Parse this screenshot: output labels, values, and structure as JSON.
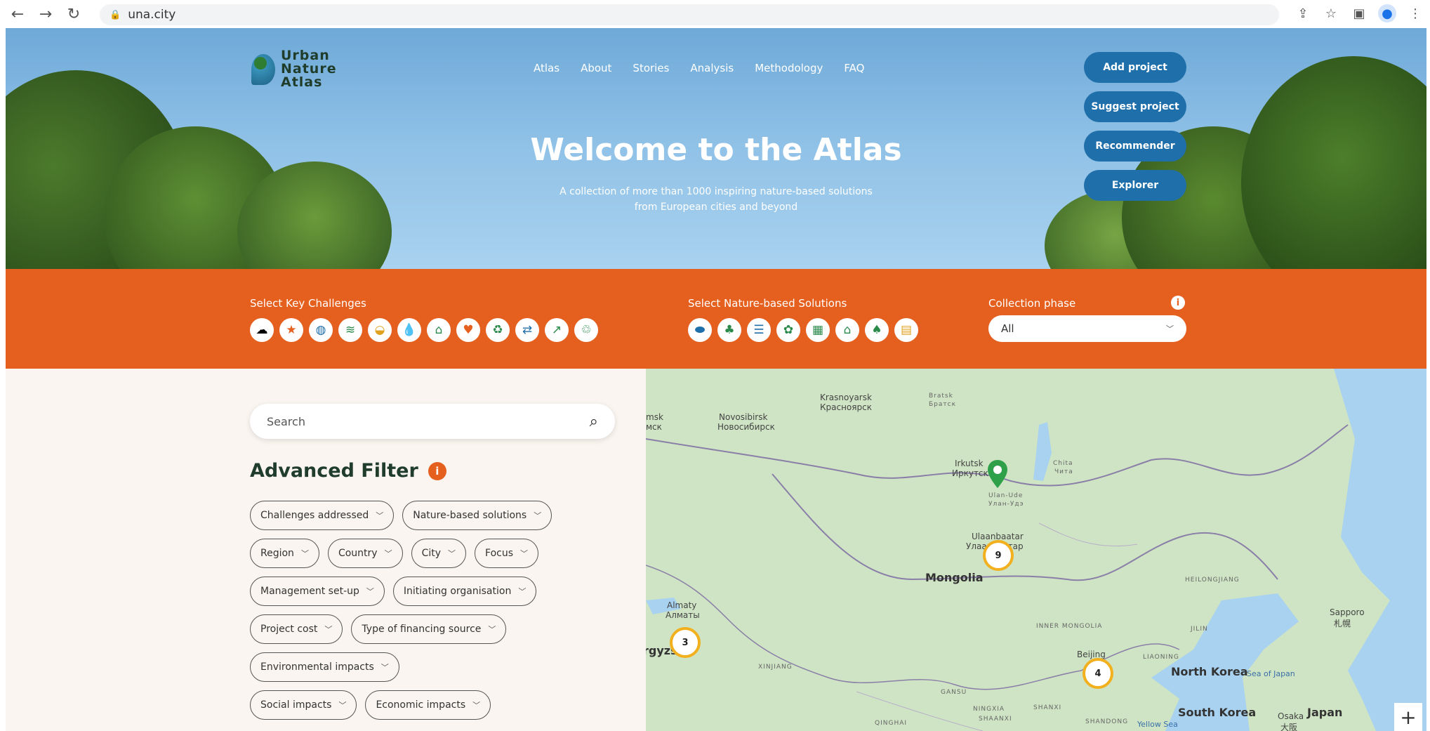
{
  "browser": {
    "url": "una.city"
  },
  "logo": {
    "line1": "Urban",
    "line2": "Nature",
    "line3": "Atlas"
  },
  "nav": [
    "Atlas",
    "About",
    "Stories",
    "Analysis",
    "Methodology",
    "FAQ"
  ],
  "hero": {
    "title": "Welcome to the Atlas",
    "subtitle_line1": "A collection of more than 1000 inspiring nature-based solutions",
    "subtitle_line2": "from European cities and beyond"
  },
  "hero_buttons": [
    "Add project",
    "Suggest project",
    "Recommender",
    "Explorer"
  ],
  "filters_band": {
    "challenges_label": "Select Key Challenges",
    "nbs_label": "Select Nature-based Solutions",
    "phase_label": "Collection phase",
    "phase_value": "All",
    "challenge_icons": [
      "cloud-icon",
      "star-icon",
      "globe-icon",
      "wetland-icon",
      "landscape-icon",
      "water-drop-icon",
      "building-icon",
      "heart-icon",
      "recycle-icon",
      "handshake-icon",
      "growth-chart-icon",
      "recycle-leaf-icon"
    ],
    "nbs_icons": [
      "blue-space-icon",
      "tree-icon",
      "water-infrastructure-icon",
      "plant-icon",
      "green-building-icon",
      "house-icon",
      "park-icon",
      "grid-icon"
    ]
  },
  "search": {
    "placeholder": "Search"
  },
  "advanced_filter": {
    "title": "Advanced Filter",
    "info": "i",
    "rows": [
      [
        "Challenges addressed",
        "Nature-based solutions"
      ],
      [
        "Region",
        "Country",
        "City",
        "Focus"
      ],
      [
        "Management set-up",
        "Initiating organisation"
      ],
      [
        "Project cost",
        "Type of financing source"
      ],
      [
        "Environmental impacts"
      ],
      [
        "Social impacts",
        "Economic impacts"
      ]
    ]
  },
  "map": {
    "labels": {
      "krasnoyarsk": "Krasnoyarsk",
      "krasnoyarsk_ru": "Красноярск",
      "bratsk": "Bratsk",
      "bratsk_ru": "Братск",
      "novosibirsk": "Novosibirsk",
      "novosibirsk_ru": "Новосибирск",
      "tomsk": "msk",
      "tomsk2": "мск",
      "irkutsk": "Irkutsk",
      "irkutsk_ru": "Иркутск",
      "ulanude": "Ulan-Ude",
      "ulanude_ru": "Улан-Удэ",
      "chita": "Chita",
      "chita_ru": "Чита",
      "ulaanbaatar": "Ulaanbaatar",
      "ulaanbaatar_ru": "Улаанбаатар",
      "mongolia": "Mongolia",
      "heilongjiang": "HEILONGJIANG",
      "almaty": "Almaty",
      "almaty_ru": "Алматы",
      "kyrgyz": "rgyzs",
      "xinjiang": "XINJIANG",
      "inner_mongolia": "INNER MONGOLIA",
      "jilin": "JILIN",
      "liaoning": "LIAONING",
      "beijing": "Beijing",
      "north_korea": "North Korea",
      "sea_of_japan": "Sea of Japan",
      "sapporo": "Sapporo",
      "sapporo_jp": "札幌",
      "gansu": "GANSU",
      "ningxia": "NINGXIA",
      "shanxi": "SHANXI",
      "shaanxi": "SHAANXI",
      "qinghai": "QINGHAI",
      "shandong": "SHANDONG",
      "yellow_sea": "Yellow Sea",
      "south_korea": "South Korea",
      "osaka": "Osaka",
      "osaka_jp": "大阪",
      "japan": "Japan"
    },
    "clusters": [
      {
        "id": "ulaanbaatar",
        "count": "9"
      },
      {
        "id": "almaty",
        "count": "3"
      },
      {
        "id": "beijing",
        "count": "4"
      }
    ],
    "zoom_in": "+"
  },
  "colors": {
    "orange": "#e5601e",
    "blue_button": "#1f6fab",
    "cluster_ring": "#f2b01e",
    "pin_green": "#2ea04a",
    "title_green": "#1f3d2a"
  }
}
